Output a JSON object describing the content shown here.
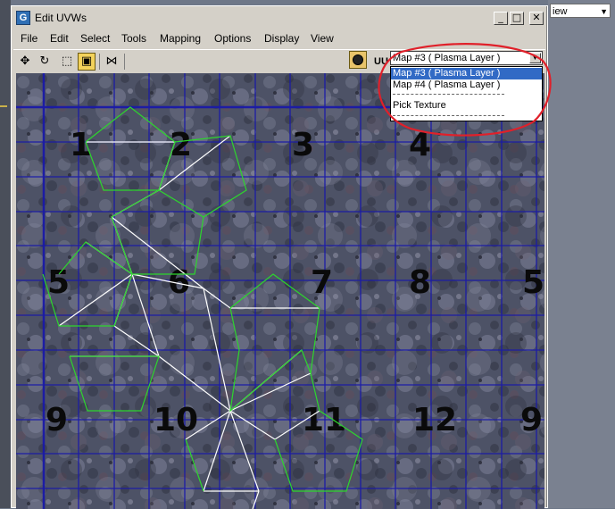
{
  "window": {
    "title": "Edit UVWs",
    "icon_letter": "G"
  },
  "title_buttons": {
    "minimize": "_",
    "maximize": "□",
    "close": "✕"
  },
  "menubar": {
    "items": [
      {
        "label": "File"
      },
      {
        "label": "Edit"
      },
      {
        "label": "Select"
      },
      {
        "label": "Tools"
      },
      {
        "label": "Mapping"
      },
      {
        "label": "Options"
      },
      {
        "label": "Display"
      },
      {
        "label": "View"
      }
    ]
  },
  "toolbar": {
    "tools": [
      {
        "name": "move-tool",
        "icon": "move-icon",
        "glyph": "✥"
      },
      {
        "name": "rotate-tool",
        "icon": "rotate-icon",
        "glyph": "↻"
      },
      {
        "name": "scale-tool",
        "icon": "scale-icon",
        "glyph": "⬚"
      },
      {
        "name": "freeform-tool",
        "icon": "freeform-icon",
        "glyph": "▣"
      },
      {
        "name": "mirror-tool",
        "icon": "mirror-icon",
        "glyph": "⋈"
      }
    ],
    "uv_label": "UU"
  },
  "map_dropdown": {
    "selected": "Map #3  ( Plasma Layer )",
    "options": [
      {
        "label": "Map #3  ( Plasma Layer )",
        "selected": true
      },
      {
        "label": "Map #4  ( Plasma Layer )",
        "selected": false
      },
      {
        "label": "Pick Texture",
        "selected": false
      }
    ]
  },
  "background_window": {
    "view_label": "iew"
  },
  "grid_labels": [
    "1",
    "2",
    "3",
    "4",
    "5",
    "6",
    "7",
    "8",
    "5",
    "9",
    "10",
    "11",
    "12",
    "9"
  ],
  "colors": {
    "grid": "#1a1aa8",
    "uv_outline": "#2dd62d",
    "uv_inner": "#ffffff",
    "annotation": "#e0202a",
    "selection": "#316ac5"
  }
}
